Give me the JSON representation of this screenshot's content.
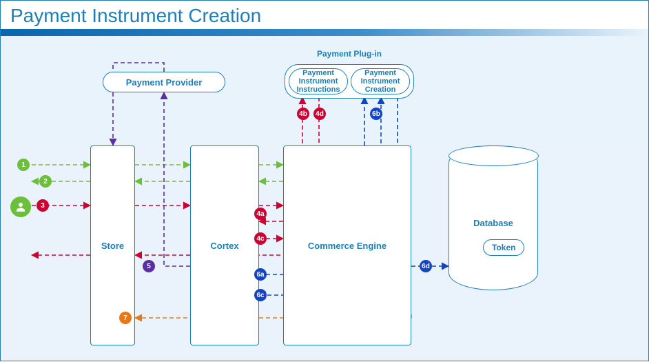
{
  "title": "Payment Instrument Creation",
  "nodes": {
    "payment_provider": "Payment Provider",
    "plugin_group": "Payment Plug-in",
    "plugin_instructions": "Payment Instrument Instructions",
    "plugin_creation": "Payment Instrument Creation",
    "store": "Store",
    "cortex": "Cortex",
    "commerce_engine": "Commerce Engine",
    "database": "Database",
    "token": "Token"
  },
  "badges": {
    "b1": "1",
    "b2": "2",
    "b3": "3",
    "b4a": "4a",
    "b4b": "4b",
    "b4c": "4c",
    "b4d": "4d",
    "b5": "5",
    "b6a": "6a",
    "b6b": "6b",
    "b6c": "6c",
    "b6d": "6d",
    "b7": "7"
  },
  "colors": {
    "green": "#6bbf3a",
    "red": "#cc0033",
    "blue": "#1344c4",
    "purple": "#5a2ea6",
    "orange": "#e77817",
    "stroke": "#1c7fb9"
  },
  "flows": [
    {
      "id": "1",
      "color": "green",
      "desc": "User → Store → Cortex → Commerce Engine (request)"
    },
    {
      "id": "2",
      "color": "green",
      "desc": "Commerce Engine → Cortex → Store → User (response)"
    },
    {
      "id": "3",
      "color": "red",
      "desc": "User → Store → Cortex → Commerce Engine (submit)"
    },
    {
      "id": "4a",
      "color": "red",
      "desc": "Commerce Engine → Cortex"
    },
    {
      "id": "4b",
      "color": "red",
      "desc": "Commerce Engine → Payment Instrument Instructions"
    },
    {
      "id": "4c",
      "color": "red",
      "desc": "Cortex → Commerce Engine"
    },
    {
      "id": "4d",
      "color": "red",
      "desc": "Payment Instrument Instructions → Commerce Engine"
    },
    {
      "id": "5",
      "color": "purple",
      "desc": "Cortex → Payment Provider → Store"
    },
    {
      "id": "6a",
      "color": "blue",
      "desc": "Cortex → Commerce Engine"
    },
    {
      "id": "6b",
      "color": "blue",
      "desc": "Commerce Engine → Payment Instrument Creation"
    },
    {
      "id": "6c",
      "color": "blue",
      "desc": "Payment Instrument Creation → Commerce Engine → Cortex"
    },
    {
      "id": "6d",
      "color": "blue",
      "desc": "Commerce Engine → Database (Token)"
    },
    {
      "id": "7",
      "color": "orange",
      "desc": "Commerce Engine → Store"
    }
  ]
}
